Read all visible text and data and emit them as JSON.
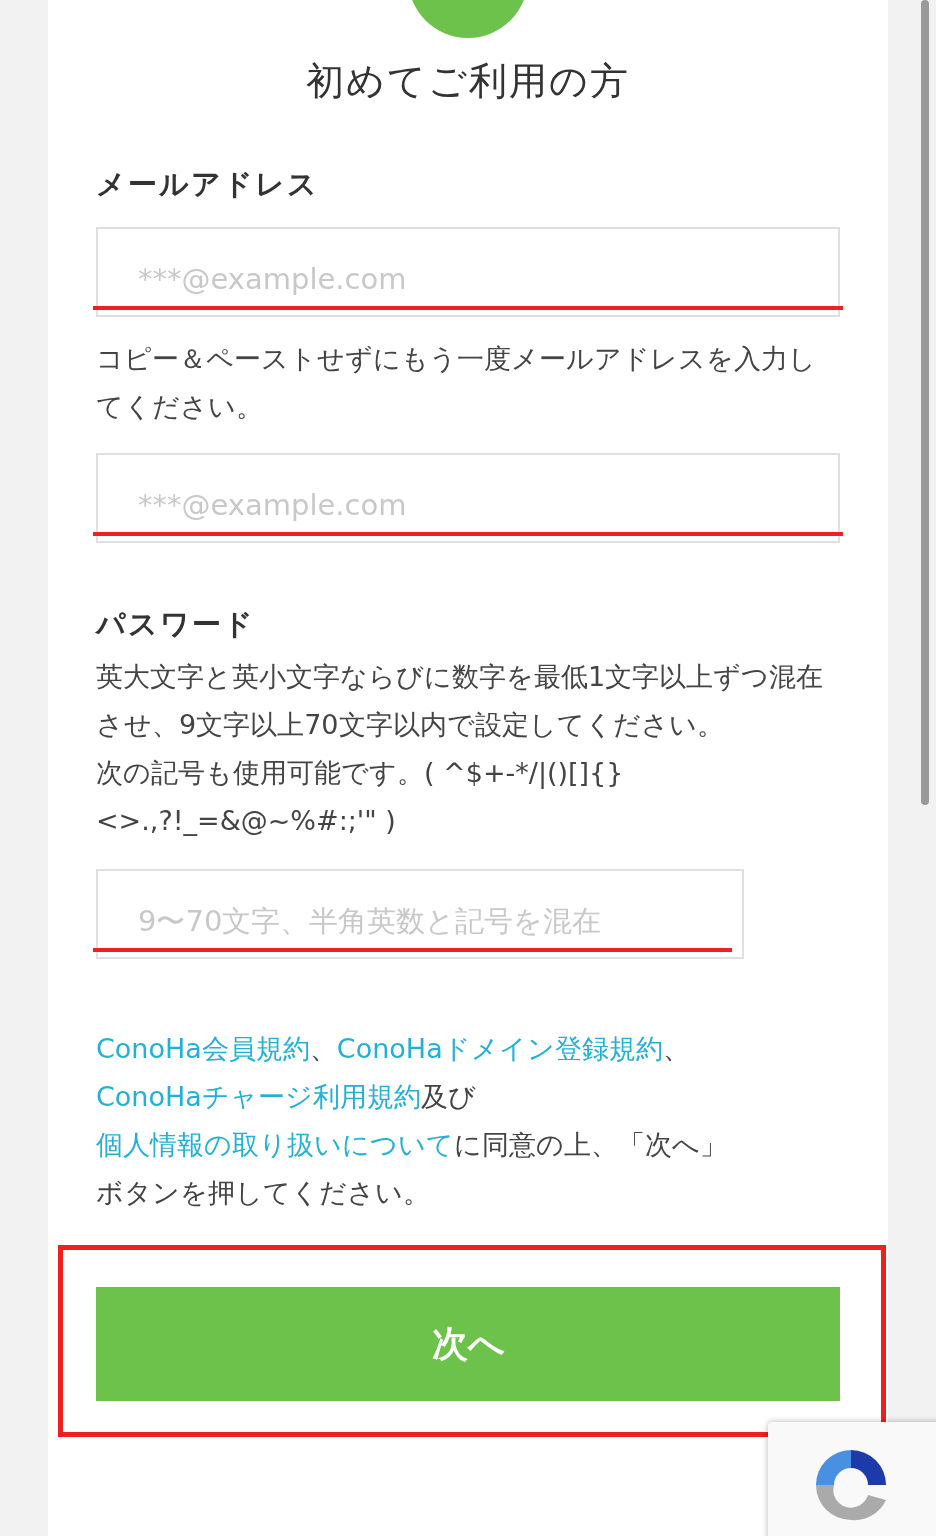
{
  "header": {
    "title": "初めてご利用の方"
  },
  "email": {
    "label": "メールアドレス",
    "placeholder": "***@example.com",
    "highlighted": true
  },
  "email_confirm": {
    "instruction": "コピー＆ペーストせずにもう一度メールアドレスを入力してください。",
    "placeholder": "***@example.com",
    "highlighted": true
  },
  "password": {
    "label": "パスワード",
    "instructions": [
      "英大文字と英小文字ならびに数字を最低1文字以上ずつ混在させ、9文字以上70文字以内で設定してください。",
      "次の記号も使用可能です。( ^$+-*/|()[]{}<>.,?!_=&@~%#:;'\" )"
    ],
    "placeholder": "9〜70文字、半角英数と記号を混在",
    "highlighted": true
  },
  "agreement": {
    "lines": [
      [
        {
          "kind": "link",
          "text": "ConoHa会員規約"
        },
        {
          "kind": "text",
          "text": "、"
        },
        {
          "kind": "link",
          "text": "ConoHaドメイン登録規約"
        },
        {
          "kind": "text",
          "text": "、"
        }
      ],
      [
        {
          "kind": "link",
          "text": "ConoHaチャージ利用規約"
        },
        {
          "kind": "text",
          "text": "及び"
        }
      ],
      [
        {
          "kind": "link",
          "text": "個人情報の取り扱いについて"
        },
        {
          "kind": "text",
          "text": "に同意の上、「次へ」"
        }
      ],
      [
        {
          "kind": "text",
          "text": "ボタンを押してください。"
        }
      ]
    ]
  },
  "next_button": {
    "label": "次へ",
    "highlighted": true
  }
}
